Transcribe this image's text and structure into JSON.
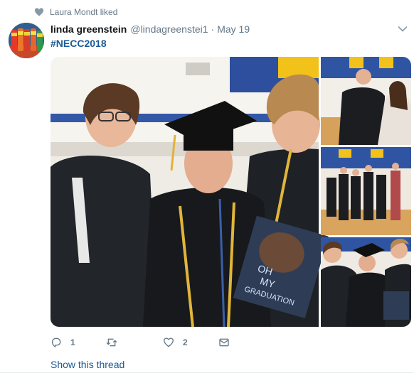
{
  "social_context": {
    "icon": "heart-icon",
    "text": "Laura Mondt liked"
  },
  "tweet": {
    "fullname": "linda greenstein",
    "handle": "@lindagreenstei1",
    "separator": "·",
    "timestamp": "May 19",
    "text": "#NECC2018"
  },
  "media": {
    "main_photo_sign": [
      "OH",
      "MY",
      "GRADUATION"
    ]
  },
  "actions": {
    "reply": {
      "icon": "reply-icon",
      "count": "1"
    },
    "retweet": {
      "icon": "retweet-icon",
      "count": ""
    },
    "like": {
      "icon": "heart-outline-icon",
      "count": "2"
    },
    "dm": {
      "icon": "envelope-icon"
    }
  },
  "show_thread_label": "Show this thread",
  "colors": {
    "link": "#1c5a96",
    "muted": "#657786",
    "heart": "#8899a6"
  }
}
